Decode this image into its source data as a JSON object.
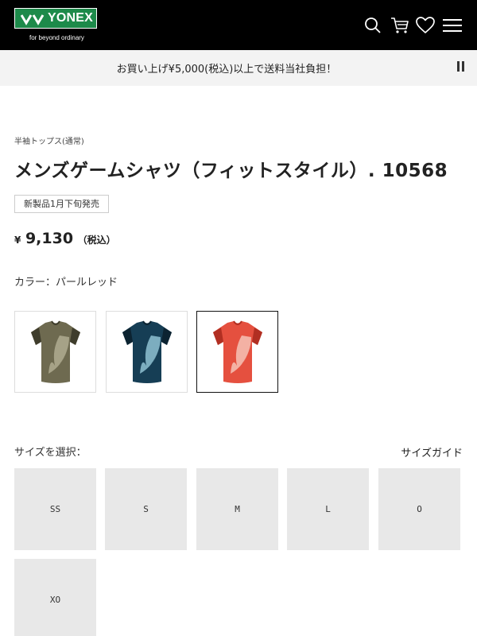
{
  "header": {
    "logo_text": "YONEX",
    "logo_tagline": "for beyond ordinary",
    "icons": [
      "search-icon",
      "cart-icon",
      "heart-icon",
      "menu-icon"
    ]
  },
  "banner": {
    "text": "お買い上げ¥5,000(税込)以上で送料当社負担！"
  },
  "product": {
    "category": "半袖トップス(通常)",
    "title": "メンズゲームシャツ（フィットスタイル）. 10568",
    "badge": "新製品1月下旬発売",
    "price_currency": "¥",
    "price_amount": "9,130",
    "price_tax": "（税込）",
    "color_label": "カラー：パールレッド",
    "color_options": [
      {
        "name": "olive",
        "base": "#6e6a50",
        "dark": "#3f3d2c",
        "accent": "#b9b59a",
        "selected": false
      },
      {
        "name": "navy-teal",
        "base": "#163e55",
        "dark": "#0c2331",
        "accent": "#9fd3e3",
        "selected": false
      },
      {
        "name": "pearl-red",
        "base": "#e5503f",
        "dark": "#b12f22",
        "accent": "#f7d1c7",
        "selected": true
      }
    ],
    "size_label": "サイズを選択：",
    "size_guide": "サイズガイド",
    "sizes": [
      "SS",
      "S",
      "M",
      "L",
      "O",
      "XO"
    ]
  },
  "colors": {
    "header_bg": "#000000",
    "logo_green": "#1d8a4a",
    "banner_bg": "#f3f3f3",
    "size_button_bg": "#e8e8e8"
  }
}
